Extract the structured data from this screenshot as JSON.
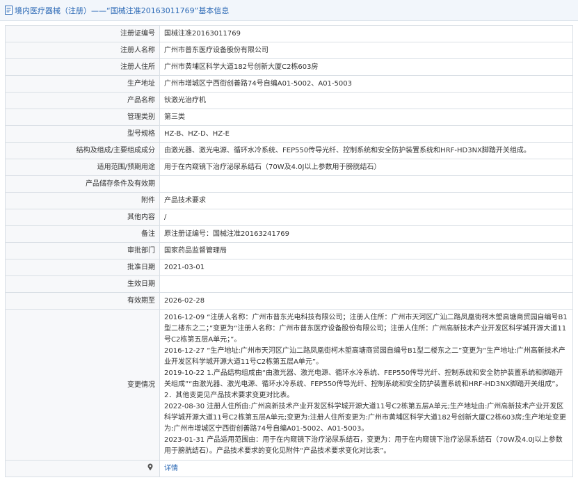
{
  "page": {
    "title": "境内医疗器械（注册）——“国械注准20163011769”基本信息"
  },
  "rows": [
    {
      "label": "注册证编号",
      "value": "国械注准20163011769"
    },
    {
      "label": "注册人名称",
      "value": "广州市普东医疗设备股份有限公司"
    },
    {
      "label": "注册人住所",
      "value": "广州市黄埔区科学大道182号创新大厦C2栋603房"
    },
    {
      "label": "生产地址",
      "value": "广州市增城区宁西街创善路74号自编A01-5002、A01-5003"
    },
    {
      "label": "产品名称",
      "value": "钬激光治疗机"
    },
    {
      "label": "管理类别",
      "value": "第三类"
    },
    {
      "label": "型号规格",
      "value": "HZ-B、HZ-D、HZ-E"
    },
    {
      "label": "结构及组成/主要组成成分",
      "value": "由激光器、激光电源、循环水冷系统、FEP550传导光纤、控制系统和安全防护装置系统和HRF-HD3NX脚踏开关组成。"
    },
    {
      "label": "适用范围/预期用途",
      "value": "用于在内窥镜下治疗泌尿系结石（70W及4.0J以上参数用于膀胱结石）"
    },
    {
      "label": "产品储存条件及有效期",
      "value": ""
    },
    {
      "label": "附件",
      "value": "产品技术要求"
    },
    {
      "label": "其他内容",
      "value": "/"
    },
    {
      "label": "备注",
      "value": "原注册证编号：国械注准20163241769"
    },
    {
      "label": "审批部门",
      "value": "国家药品监督管理局"
    },
    {
      "label": "批准日期",
      "value": "2021-03-01"
    },
    {
      "label": "生效日期",
      "value": ""
    },
    {
      "label": "有效期至",
      "value": "2026-02-28"
    }
  ],
  "changes": {
    "label": "变更情况",
    "items": [
      "2016-12-09 “注册人名称：广州市普东光电科技有限公司；注册人住所：广州市天河区广汕二路凤凰街柯木塱高塘商贸园自编号B1型二楼东之二；”变更为“注册人名称：广州市普东医疗设备股份有限公司；注册人住所：广州高新技术产业开发区科学城开源大道11号C2栋第五层A单元；”。",
      "2016-12-27 “生产地址:广州市天河区广汕二路凤凰街柯木塱高塘商贸园自编号B1型二楼东之二”变更为“生产地址:广州高新技术产业开发区科学城开源大道11号C2栋第五层A单元”。",
      "2019-10-22 1.产品结构组成由“由激光器、激光电源、循环水冷系统、FEP550传导光纤、控制系统和安全防护装置系统和脚踏开关组成”“由激光器、激光电源、循环水冷系统、FEP550传导光纤、控制系统和安全防护装置系统和HRF-HD3NX脚踏开关组成”。",
      "2．其他变更见产品技术要求变更对比表。",
      "2022-08-30 注册人住所由:广州高新技术产业开发区科学城开源大道11号C2栋第五层A单元;生产地址由:广州高新技术产业开发区科学城开源大道11号C2栋第五层A单元;变更为:注册人住所变更为:广州市黄埔区科学大道182号创新大厦C2栋603房;生产地址变更为:广州市增城区宁西街创善路74号自编A01-5002、A01-5003。",
      "2023-01-31 产品适用范围由：用于在内窥镜下治疗泌尿系结石，变更为：用于在内窥镜下治疗泌尿系结石（70W及4.0J以上参数用于膀胱结石）。产品技术要求的变化见附件“产品技术要求变化对比表”。"
    ]
  },
  "footer": {
    "link_text": "详情"
  },
  "icons": {
    "title": "document-icon",
    "pin": "map-pin-icon"
  },
  "colors": {
    "accent": "#2a68b5",
    "label_bg": "#f7f8fa",
    "border": "#d9dfe5"
  }
}
